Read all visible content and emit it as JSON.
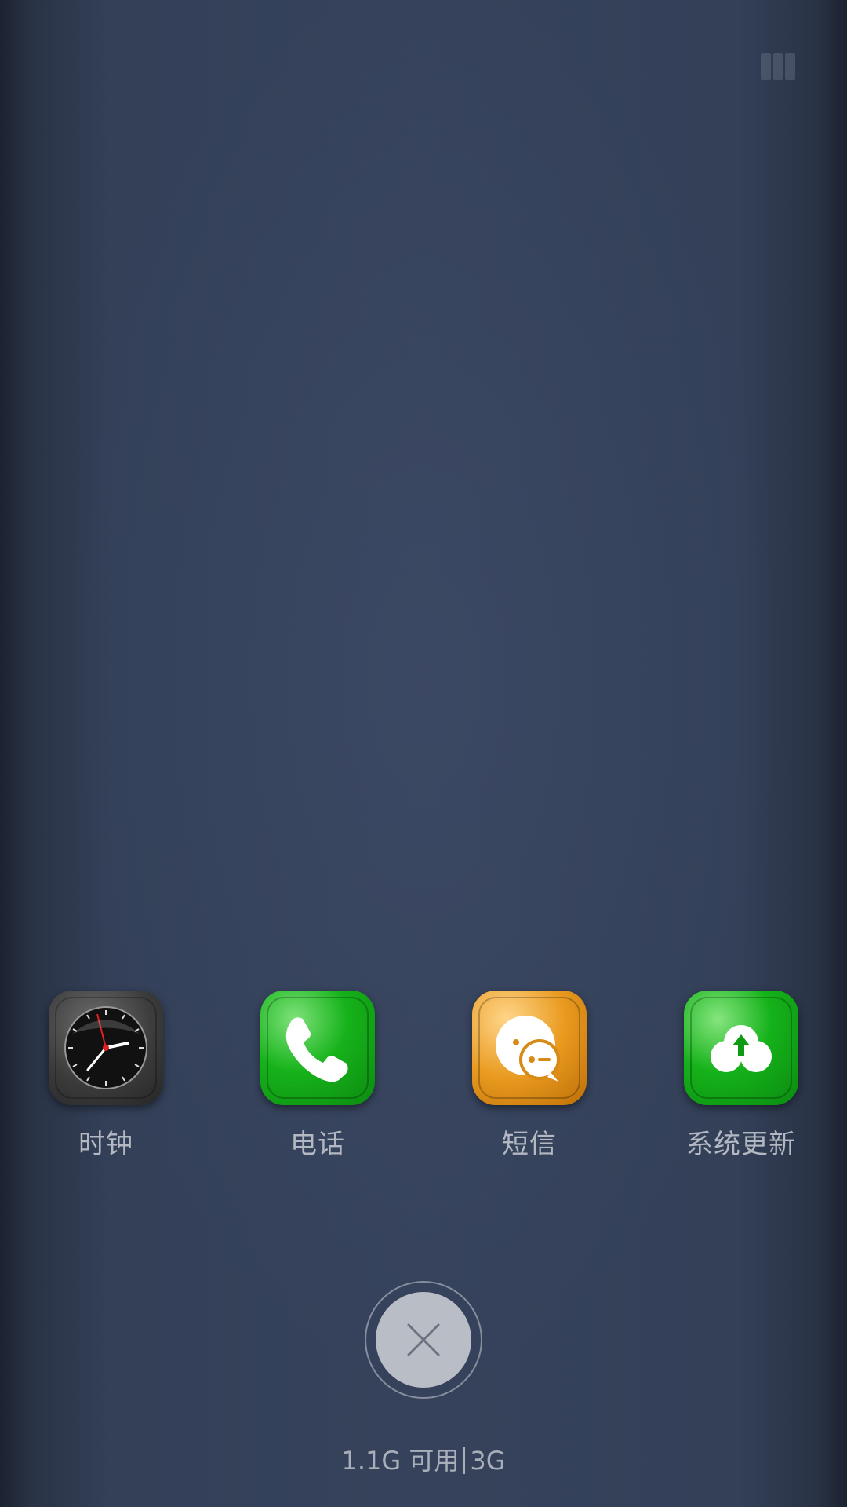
{
  "apps": [
    {
      "label": "时钟",
      "icon": "clock-icon"
    },
    {
      "label": "电话",
      "icon": "phone-icon"
    },
    {
      "label": "短信",
      "icon": "sms-icon"
    },
    {
      "label": "系统更新",
      "icon": "system-update-icon"
    }
  ],
  "close_button": {
    "icon": "close-icon"
  },
  "memory": {
    "available": "1.1G 可用",
    "total": "3G"
  },
  "colors": {
    "background": "#2c3548",
    "label": "#b3b8c2",
    "close_button": "#b9bdc6"
  }
}
